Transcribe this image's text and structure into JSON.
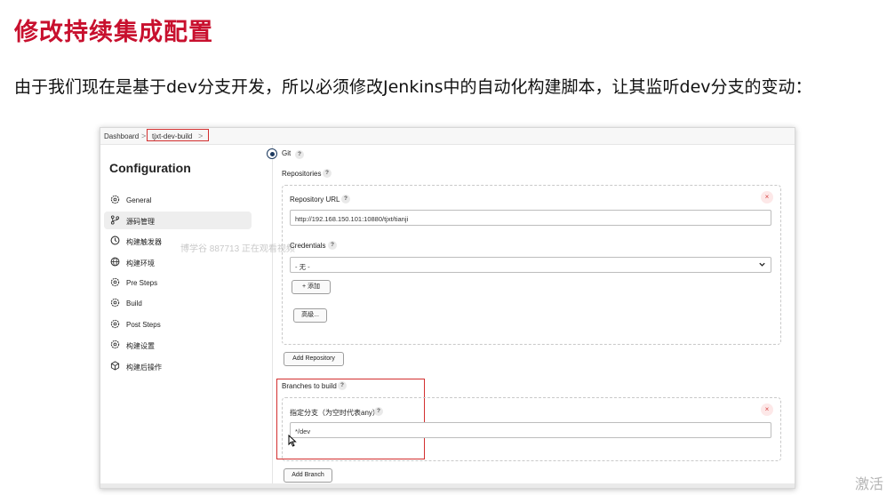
{
  "slide": {
    "title": "修改持续集成配置",
    "text": "由于我们现在是基于dev分支开发，所以必须修改Jenkins中的自动化构建脚本，让其监听dev分支的变动：",
    "corner": "激活"
  },
  "breadcrumb": {
    "dashboard": "Dashboard",
    "separator": ">",
    "job": "tjxt-dev-build"
  },
  "sidebar": {
    "title": "Configuration",
    "items": [
      {
        "label": "General",
        "icon": "gear-icon"
      },
      {
        "label": "源码管理",
        "icon": "branch-icon",
        "active": true
      },
      {
        "label": "构建触发器",
        "icon": "clock-icon"
      },
      {
        "label": "构建环境",
        "icon": "globe-icon"
      },
      {
        "label": "Pre Steps",
        "icon": "gear-icon"
      },
      {
        "label": "Build",
        "icon": "gear-icon"
      },
      {
        "label": "Post Steps",
        "icon": "gear-icon"
      },
      {
        "label": "构建设置",
        "icon": "gear-icon"
      },
      {
        "label": "构建后操作",
        "icon": "cube-icon"
      }
    ]
  },
  "scm": {
    "git_label": "Git",
    "help": "?",
    "repositories_label": "Repositories",
    "repo_url_label": "Repository URL",
    "repo_url_value": "http://192.168.150.101:10880/tjxt/tianji",
    "credentials_label": "Credentials",
    "credentials_value": "- 无 -",
    "add_label": "添加",
    "add_prefix": "+",
    "advanced_label": "高级...",
    "add_repository_label": "Add Repository",
    "branches_label": "Branches to build",
    "branch_spec_label": "指定分支（为空时代表any）",
    "branch_spec_value": "*/dev",
    "add_branch_label": "Add Branch",
    "close": "×"
  },
  "watermark": "博学谷 887713 正在观看视频",
  "colors": {
    "title_red": "#c8102e",
    "highlight_red": "#d32f2f",
    "radio_blue": "#1d3a5f"
  }
}
